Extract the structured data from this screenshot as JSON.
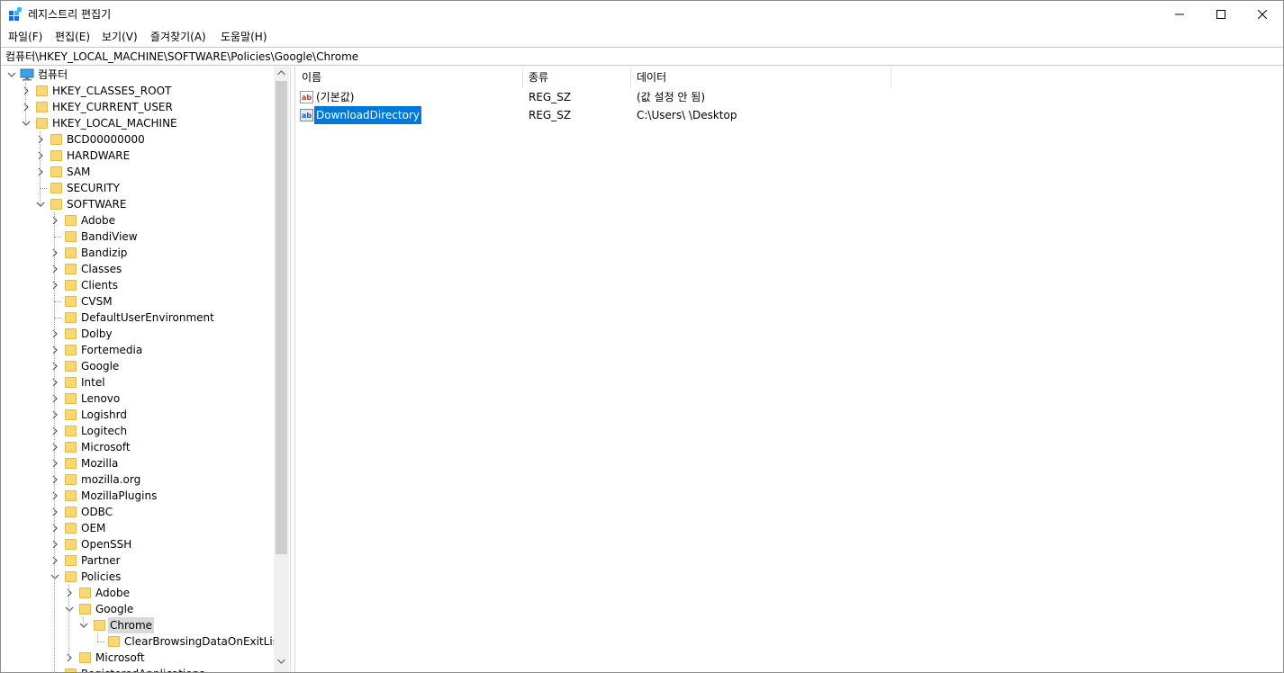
{
  "window": {
    "title": "레지스트리 편집기"
  },
  "menu": [
    "파일(F)",
    "편집(E)",
    "보기(V)",
    "즐겨찾기(A)",
    "도움말(H)"
  ],
  "address": "컴퓨터\\HKEY_LOCAL_MACHINE\\SOFTWARE\\Policies\\Google\\Chrome",
  "tree": [
    {
      "label": "컴퓨터",
      "level": 0,
      "expander": "open",
      "icon": "computer-icon"
    },
    {
      "label": "HKEY_CLASSES_ROOT",
      "level": 1,
      "expander": "closed"
    },
    {
      "label": "HKEY_CURRENT_USER",
      "level": 1,
      "expander": "closed"
    },
    {
      "label": "HKEY_LOCAL_MACHINE",
      "level": 1,
      "expander": "open"
    },
    {
      "label": "BCD00000000",
      "level": 2,
      "expander": "closed"
    },
    {
      "label": "HARDWARE",
      "level": 2,
      "expander": "closed"
    },
    {
      "label": "SAM",
      "level": 2,
      "expander": "closed"
    },
    {
      "label": "SECURITY",
      "level": 2,
      "expander": "none"
    },
    {
      "label": "SOFTWARE",
      "level": 2,
      "expander": "open"
    },
    {
      "label": "Adobe",
      "level": 3,
      "expander": "closed"
    },
    {
      "label": "BandiView",
      "level": 3,
      "expander": "none"
    },
    {
      "label": "Bandizip",
      "level": 3,
      "expander": "closed"
    },
    {
      "label": "Classes",
      "level": 3,
      "expander": "closed"
    },
    {
      "label": "Clients",
      "level": 3,
      "expander": "closed"
    },
    {
      "label": "CVSM",
      "level": 3,
      "expander": "none"
    },
    {
      "label": "DefaultUserEnvironment",
      "level": 3,
      "expander": "none"
    },
    {
      "label": "Dolby",
      "level": 3,
      "expander": "closed"
    },
    {
      "label": "Fortemedia",
      "level": 3,
      "expander": "closed"
    },
    {
      "label": "Google",
      "level": 3,
      "expander": "closed"
    },
    {
      "label": "Intel",
      "level": 3,
      "expander": "closed"
    },
    {
      "label": "Lenovo",
      "level": 3,
      "expander": "closed"
    },
    {
      "label": "Logishrd",
      "level": 3,
      "expander": "closed"
    },
    {
      "label": "Logitech",
      "level": 3,
      "expander": "closed"
    },
    {
      "label": "Microsoft",
      "level": 3,
      "expander": "closed"
    },
    {
      "label": "Mozilla",
      "level": 3,
      "expander": "closed"
    },
    {
      "label": "mozilla.org",
      "level": 3,
      "expander": "closed"
    },
    {
      "label": "MozillaPlugins",
      "level": 3,
      "expander": "closed"
    },
    {
      "label": "ODBC",
      "level": 3,
      "expander": "closed"
    },
    {
      "label": "OEM",
      "level": 3,
      "expander": "closed"
    },
    {
      "label": "OpenSSH",
      "level": 3,
      "expander": "closed"
    },
    {
      "label": "Partner",
      "level": 3,
      "expander": "closed"
    },
    {
      "label": "Policies",
      "level": 3,
      "expander": "open"
    },
    {
      "label": "Adobe",
      "level": 4,
      "expander": "closed"
    },
    {
      "label": "Google",
      "level": 4,
      "expander": "open"
    },
    {
      "label": "Chrome",
      "level": 5,
      "expander": "open",
      "selected": true
    },
    {
      "label": "ClearBrowsingDataOnExitList",
      "level": 6,
      "expander": "none"
    },
    {
      "label": "Microsoft",
      "level": 4,
      "expander": "closed"
    },
    {
      "label": "RegisteredApplications",
      "level": 3,
      "expander": "none"
    }
  ],
  "list": {
    "columns": [
      "이름",
      "종류",
      "데이터"
    ],
    "rows": [
      {
        "name": "(기본값)",
        "type": "REG_SZ",
        "data": "(값 설정 안 됨)",
        "selected": false
      },
      {
        "name": "DownloadDirectory",
        "type": "REG_SZ",
        "data": "C:\\Users\\        \\Desktop",
        "selected": true
      }
    ]
  },
  "colors": {
    "selection": "#0078d7",
    "tree_selection": "#d9d9d9",
    "folder": "#f8d775"
  }
}
